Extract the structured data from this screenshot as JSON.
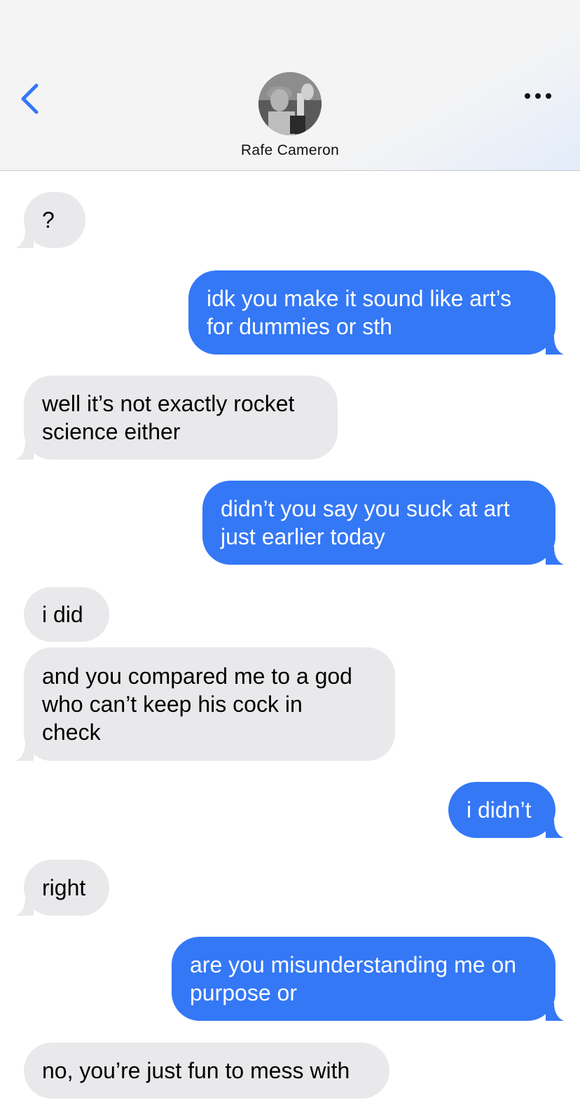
{
  "header": {
    "contact_name": "Rafe Cameron",
    "back_icon": "chevron-left-icon",
    "more_icon": "ellipsis-icon",
    "accent_color": "#3478f6"
  },
  "colors": {
    "sent_bubble": "#3478f6",
    "received_bubble": "#e9e9eb"
  },
  "messages": [
    {
      "from": "them",
      "text": "?"
    },
    {
      "from": "me",
      "lines": [
        "idk you make it sound like art’s",
        "for dummies or sth"
      ]
    },
    {
      "from": "them",
      "lines": [
        "well it’s not exactly rocket",
        "science either"
      ]
    },
    {
      "from": "me",
      "lines": [
        "didn’t you say you suck at art",
        "just earlier today"
      ]
    },
    {
      "from": "them",
      "text": "i did"
    },
    {
      "from": "them",
      "lines": [
        "and you compared me to a god",
        "who can’t keep his cock in",
        "check"
      ]
    },
    {
      "from": "me",
      "text": "i didn’t"
    },
    {
      "from": "them",
      "text": "right"
    },
    {
      "from": "me",
      "lines": [
        "are you misunderstanding me on",
        "purpose or"
      ]
    },
    {
      "from": "them",
      "text": "no, you’re just fun to mess with"
    }
  ]
}
